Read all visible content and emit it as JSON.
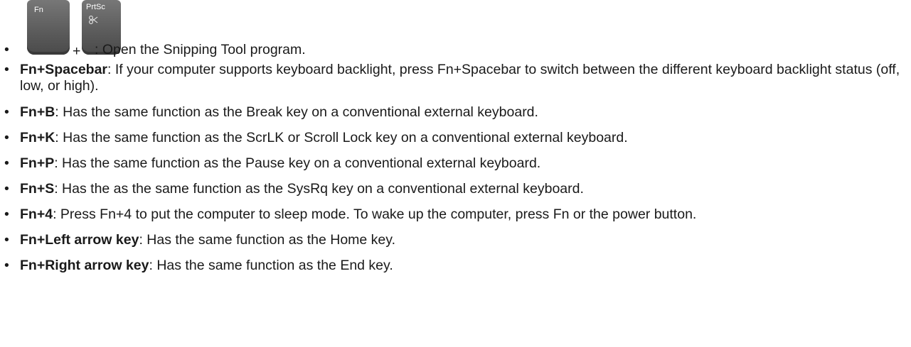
{
  "keys": {
    "fn_label": "Fn",
    "prtsc_label": "PrtSc",
    "prtsc_icon": "snipping-tool-icon",
    "plus": "+"
  },
  "items": [
    {
      "term": "",
      "sep": "",
      "text": ": Open the Snipping Tool program."
    },
    {
      "term": "Fn+Spacebar",
      "sep": ":",
      "text": " If your computer supports keyboard backlight, press Fn+Spacebar to switch between the different keyboard backlight status (off, low, or high)."
    },
    {
      "term": "Fn+B",
      "sep": ":",
      "text": " Has the same function as the Break key on a conventional external keyboard."
    },
    {
      "term": "Fn+K",
      "sep": ":",
      "text": " Has the same function as the ScrLK or Scroll Lock key on a conventional external keyboard."
    },
    {
      "term": "Fn+P",
      "sep": ":",
      "text": " Has the same function as the Pause key on a conventional external keyboard."
    },
    {
      "term": "Fn+S",
      "sep": ":",
      "text": " Has the as the same function as the SysRq key on a conventional external keyboard."
    },
    {
      "term": "Fn+4",
      "sep": ":",
      "text": " Press Fn+4 to put the computer to sleep mode. To wake up the computer, press Fn or the power button."
    },
    {
      "term": "Fn+Left arrow key",
      "sep": ":",
      "text": " Has the same function as the Home key."
    },
    {
      "term": "Fn+Right arrow key",
      "sep": ":",
      "text": " Has the same function as the End key."
    }
  ],
  "bullet": "•"
}
